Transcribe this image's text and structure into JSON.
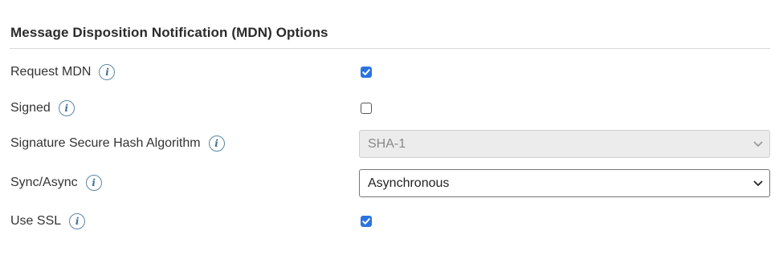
{
  "section": {
    "title": "Message Disposition Notification (MDN) Options"
  },
  "fields": {
    "request_mdn": {
      "label": "Request MDN",
      "checked": true
    },
    "signed": {
      "label": "Signed",
      "checked": false
    },
    "hash_algorithm": {
      "label": "Signature Secure Hash Algorithm",
      "value": "SHA-1",
      "disabled": true
    },
    "sync_async": {
      "label": "Sync/Async",
      "value": "Asynchronous"
    },
    "use_ssl": {
      "label": "Use SSL",
      "checked": true
    }
  },
  "info_glyph": "i",
  "colors": {
    "accent": "#2b73e0",
    "info": "#3f6f91",
    "divider": "#d9d9d9"
  }
}
